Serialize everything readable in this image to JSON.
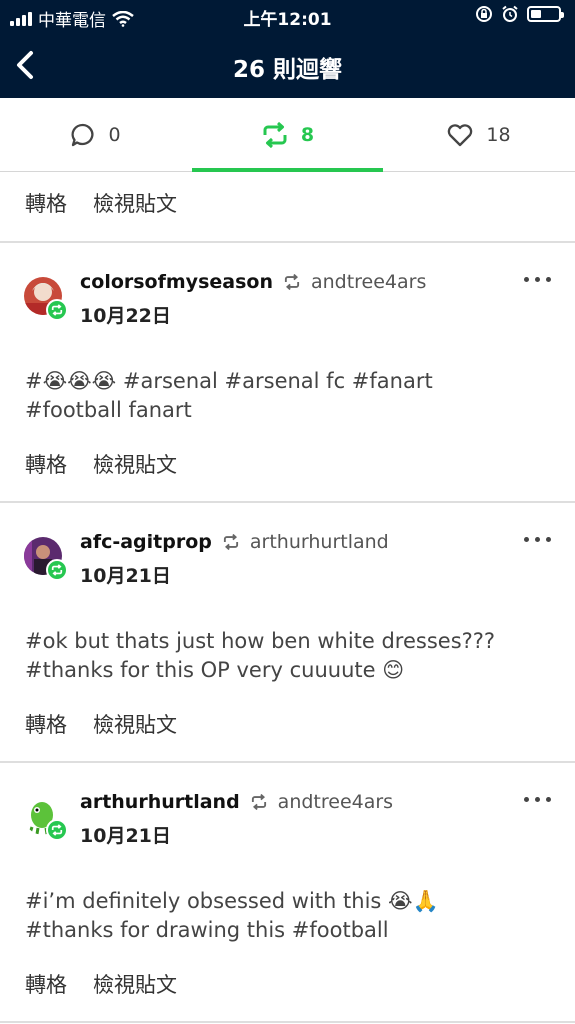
{
  "status_bar": {
    "carrier": "中華電信",
    "time": "上午12:01"
  },
  "header": {
    "title": "26 則迴響"
  },
  "tabs": [
    {
      "icon": "comment-icon",
      "count": "0",
      "active": false
    },
    {
      "icon": "reblog-icon",
      "count": "8",
      "active": true
    },
    {
      "icon": "heart-icon",
      "count": "18",
      "active": false
    }
  ],
  "actions": {
    "reblog": "轉格",
    "view_post": "檢視貼文"
  },
  "posts": [
    {
      "username": "colorsofmyseason",
      "source": "andtree4ars",
      "date": "10月22日",
      "line1": "#😭😭😭  #arsenal  #arsenal fc  #fanart",
      "line2": "#football fanart"
    },
    {
      "username": "afc-agitprop",
      "source": "arthurhurtland",
      "date": "10月21日",
      "line1": "#ok but thats just how ben white dresses???",
      "line2": "#thanks for this OP very cuuuute 😊"
    },
    {
      "username": "arthurhurtland",
      "source": "andtree4ars",
      "date": "10月21日",
      "line1": "#i’m definitely obsessed with this 😭🙏",
      "line2": "#thanks for drawing this  #football"
    }
  ],
  "colors": {
    "header_bg": "#001935",
    "accent_green": "#26c750"
  }
}
